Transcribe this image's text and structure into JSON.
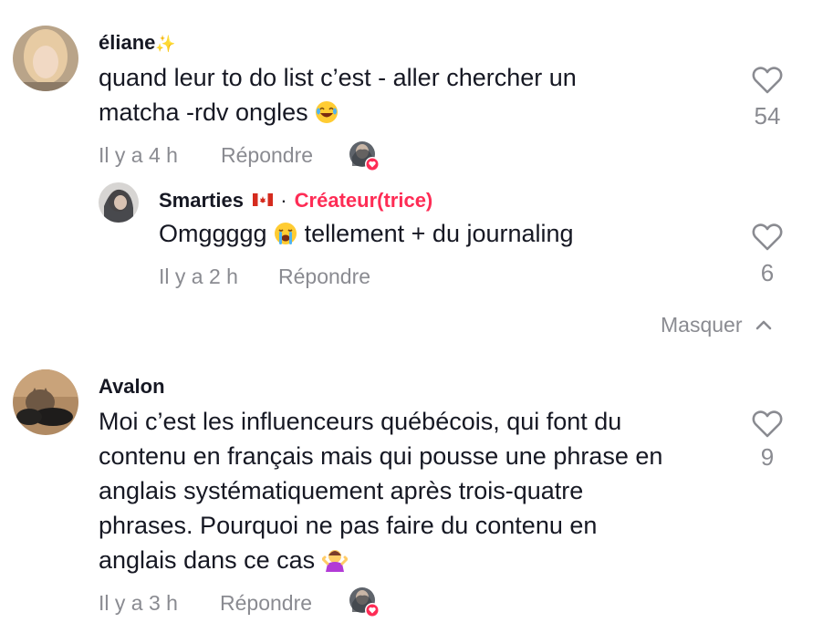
{
  "comments": [
    {
      "username": "éliane",
      "username_emoji": "✨",
      "text_line1": "quand leur to do list c’est - aller chercher un",
      "text_line2": "matcha -rdv ongles",
      "text_emoji": "😂",
      "time": "Il y a 4 h",
      "reply_label": "Répondre",
      "likes": "54",
      "creator_liked": true
    },
    {
      "username": "Smarties",
      "flag": "🇨🇦",
      "separator": "·",
      "role": "Créateur(trice)",
      "text_before": "Omggggg",
      "text_emoji": "😭",
      "text_after": "tellement + du journaling",
      "time": "Il y a 2 h",
      "reply_label": "Répondre",
      "likes": "6"
    },
    {
      "username": "Avalon",
      "text_line1": "Moi c’est les influenceurs québécois, qui font du",
      "text_line2": "contenu en français mais qui pousse une phrase en",
      "text_line3": "anglais systématiquement après trois-quatre",
      "text_line4": "phrases. Pourquoi ne pas faire du contenu en",
      "text_line5": "anglais dans ce cas",
      "text_emoji": "🤷‍♀️",
      "time": "Il y a 3 h",
      "reply_label": "Répondre",
      "likes": "9",
      "creator_liked": true
    }
  ],
  "hide_replies_label": "Masquer",
  "colors": {
    "accent": "#fe2c55",
    "muted": "#8a8b91",
    "text": "#161823"
  },
  "icons": {
    "like": "heart-outline-icon",
    "collapse": "chevron-up-icon",
    "liked_badge": "heart-badge-icon"
  }
}
